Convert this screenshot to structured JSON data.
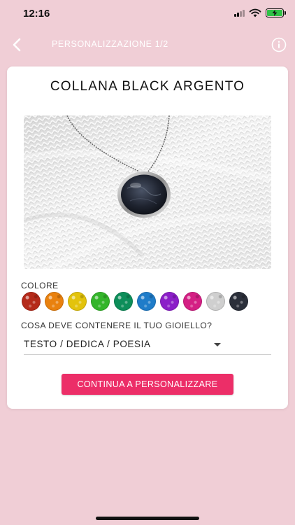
{
  "status_bar": {
    "time": "12:16",
    "battery_level": 1.0,
    "battery_color": "#2fc247"
  },
  "nav": {
    "title": "PERSONALIZZAZIONE 1/2",
    "back_icon": "chevron-left-icon",
    "info_icon": "info-circle-icon"
  },
  "product": {
    "title": "COLLANA BLACK ARGENTO"
  },
  "color_section": {
    "label": "COLORE",
    "swatches": [
      {
        "color": "#b52a1a"
      },
      {
        "color": "#e9810e"
      },
      {
        "color": "#e3c30c"
      },
      {
        "color": "#34b52a"
      },
      {
        "color": "#0d8e5a"
      },
      {
        "color": "#1f7cc9"
      },
      {
        "color": "#8b1ec8"
      },
      {
        "color": "#d41f84"
      },
      {
        "color": "#cfcfcf"
      },
      {
        "color": "#2b2f3a"
      }
    ]
  },
  "content_section": {
    "question": "COSA DEVE CONTENERE IL TUO GIOIELLO?",
    "selected_value": "TESTO / DEDICA / POESIA"
  },
  "cta": {
    "label": "CONTINUA A PERSONALIZZARE",
    "color": "#ec2e68"
  },
  "theme": {
    "background": "#f0ced6",
    "card": "#ffffff"
  }
}
